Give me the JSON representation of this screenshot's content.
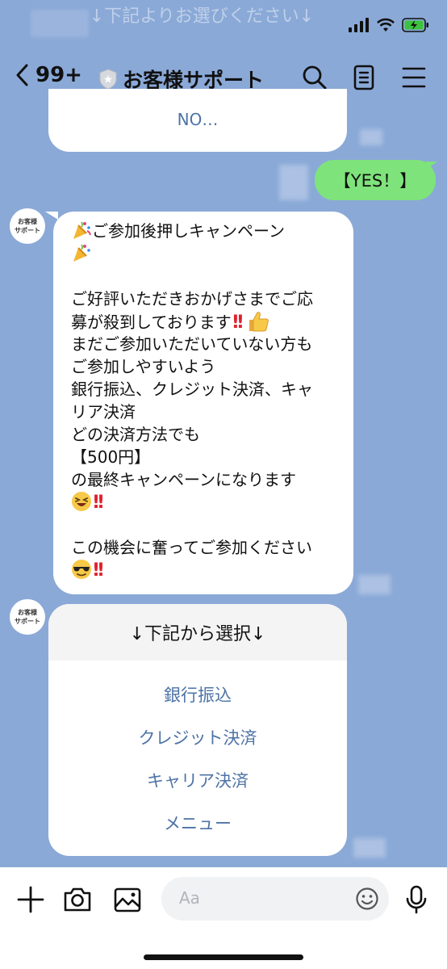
{
  "status_bar": {
    "background_hint": "↓下記よりお選びください↓"
  },
  "header": {
    "unread_count": "99+",
    "title": "お客様サポート"
  },
  "avatar": {
    "line1": "お客様",
    "line2": "サポート"
  },
  "previous_menu": {
    "option": "NO…"
  },
  "messages": {
    "user_reply": "【YES！】",
    "campaign": {
      "line1": "ご参加後押しキャンペーン",
      "line2": "ご好評いただきおかげさまでご応",
      "line3": "募が殺到しております",
      "line4": "まだご参加いただいていない方も",
      "line5": "ご参加しやすいよう",
      "line6": "銀行振込、クレジット決済、キャ",
      "line7": "リア決済",
      "line8": "どの決済方法でも",
      "line9": "【500円】",
      "line10": "の最終キャンペーンになります",
      "line11": "この機会に奮ってご参加ください"
    }
  },
  "menu": {
    "header": "↓下記から選択↓",
    "options": [
      "銀行振込",
      "クレジット決済",
      "キャリア決済",
      "メニュー"
    ]
  },
  "input": {
    "placeholder": "Aa"
  },
  "icons": {
    "back": "chevron-left-icon",
    "verified": "shield-badge-icon",
    "search": "search-icon",
    "notes": "notes-icon",
    "menu": "hamburger-menu-icon",
    "add": "plus-icon",
    "camera": "camera-icon",
    "image": "image-icon",
    "emoji": "smiley-icon",
    "mic": "microphone-icon"
  },
  "colors": {
    "chat_background": "#8aa9d7",
    "sent_bubble": "#7ee37b",
    "link_text": "#4e73a6",
    "battery": "#3cc23c"
  }
}
